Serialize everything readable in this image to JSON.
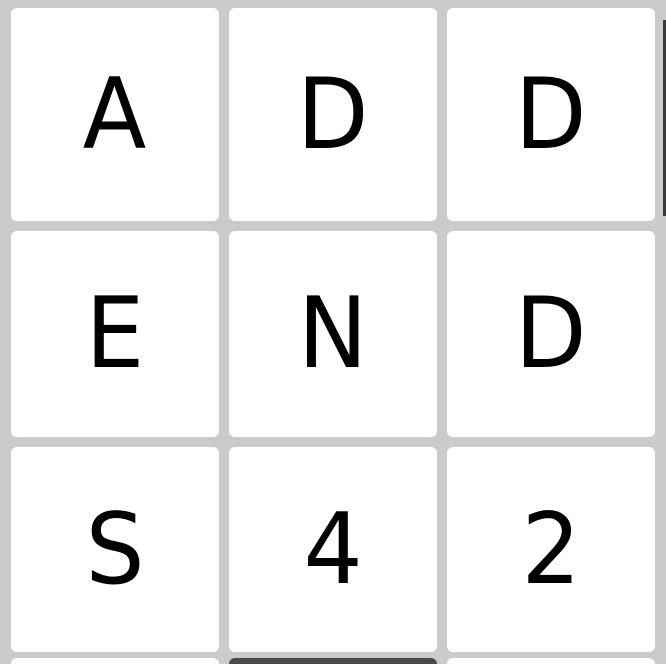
{
  "tiles": [
    {
      "value": "A"
    },
    {
      "value": "D"
    },
    {
      "value": "D"
    },
    {
      "value": "E"
    },
    {
      "value": "N"
    },
    {
      "value": "D"
    },
    {
      "value": "S"
    },
    {
      "value": "4"
    },
    {
      "value": "2"
    }
  ],
  "colors": {
    "background": "#cbcbcb",
    "tile": "#ffffff",
    "text": "#000000",
    "peek_dark": "#4a4a4a"
  }
}
